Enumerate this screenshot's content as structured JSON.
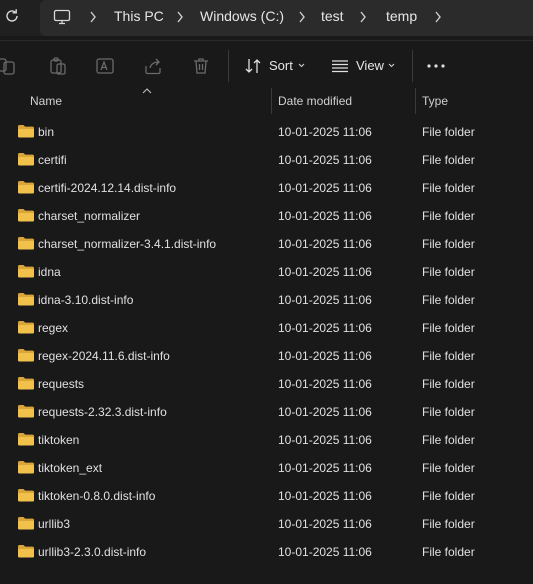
{
  "breadcrumb": {
    "items": [
      "This PC",
      "Windows (C:)",
      "test",
      "temp"
    ]
  },
  "toolbar": {
    "sort_label": "Sort",
    "view_label": "View",
    "icons": [
      "new-item-icon",
      "copy-icon",
      "rename-icon",
      "share-icon",
      "delete-icon",
      "sort-icon",
      "view-icon",
      "more-icon"
    ]
  },
  "columns": {
    "name": "Name",
    "date": "Date modified",
    "type": "Type"
  },
  "files": [
    {
      "name": "bin",
      "date": "10-01-2025 11:06",
      "type": "File folder"
    },
    {
      "name": "certifi",
      "date": "10-01-2025 11:06",
      "type": "File folder"
    },
    {
      "name": "certifi-2024.12.14.dist-info",
      "date": "10-01-2025 11:06",
      "type": "File folder"
    },
    {
      "name": "charset_normalizer",
      "date": "10-01-2025 11:06",
      "type": "File folder"
    },
    {
      "name": "charset_normalizer-3.4.1.dist-info",
      "date": "10-01-2025 11:06",
      "type": "File folder"
    },
    {
      "name": "idna",
      "date": "10-01-2025 11:06",
      "type": "File folder"
    },
    {
      "name": "idna-3.10.dist-info",
      "date": "10-01-2025 11:06",
      "type": "File folder"
    },
    {
      "name": "regex",
      "date": "10-01-2025 11:06",
      "type": "File folder"
    },
    {
      "name": "regex-2024.11.6.dist-info",
      "date": "10-01-2025 11:06",
      "type": "File folder"
    },
    {
      "name": "requests",
      "date": "10-01-2025 11:06",
      "type": "File folder"
    },
    {
      "name": "requests-2.32.3.dist-info",
      "date": "10-01-2025 11:06",
      "type": "File folder"
    },
    {
      "name": "tiktoken",
      "date": "10-01-2025 11:06",
      "type": "File folder"
    },
    {
      "name": "tiktoken_ext",
      "date": "10-01-2025 11:06",
      "type": "File folder"
    },
    {
      "name": "tiktoken-0.8.0.dist-info",
      "date": "10-01-2025 11:06",
      "type": "File folder"
    },
    {
      "name": "urllib3",
      "date": "10-01-2025 11:06",
      "type": "File folder"
    },
    {
      "name": "urllib3-2.3.0.dist-info",
      "date": "10-01-2025 11:06",
      "type": "File folder"
    }
  ],
  "colors": {
    "background": "#191919",
    "folder": "#f2c14b",
    "folder_dark": "#d9a43a"
  }
}
